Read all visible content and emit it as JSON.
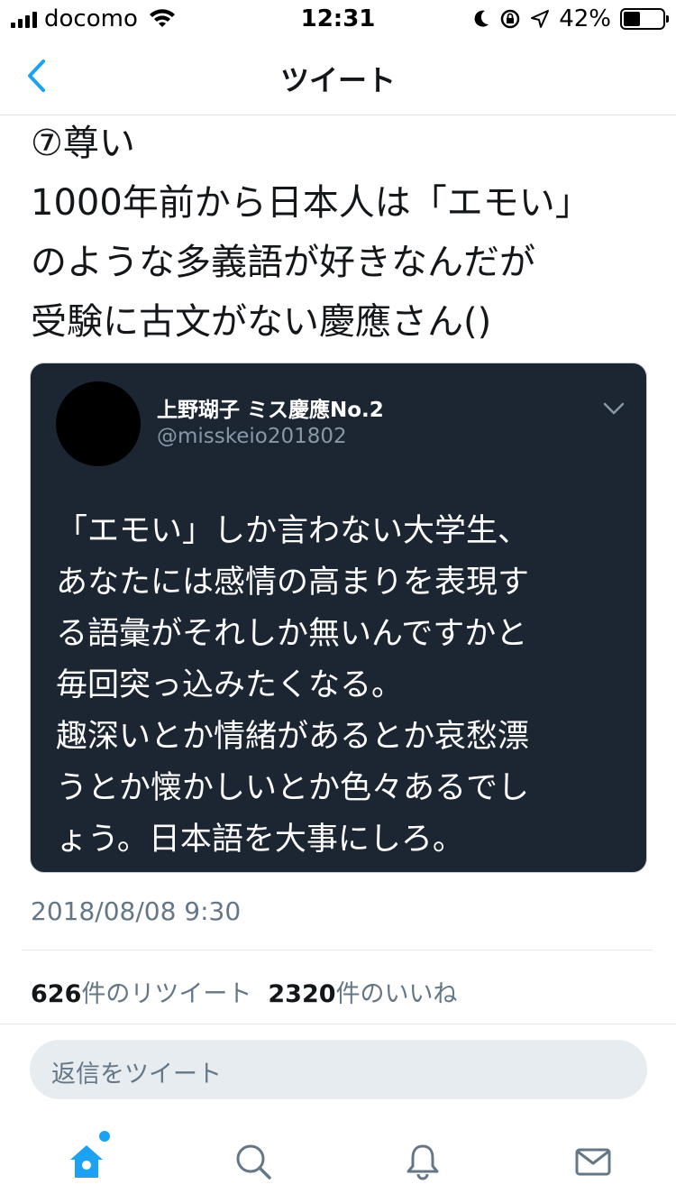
{
  "status_bar": {
    "carrier": "docomo",
    "time": "12:31",
    "battery_pct": "42%",
    "battery_level": 0.42
  },
  "nav": {
    "title": "ツイート",
    "back_icon": "chevron-left-icon"
  },
  "tweet": {
    "text": "⑦尊い\n1000年前から日本人は「エモい」\nのような多義語が好きなんだが\n受験に古文がない慶應さん()"
  },
  "embedded": {
    "name": "上野瑚子 ミス慶應No.2",
    "handle": "@misskeio201802",
    "body": "「エモい」しか言わない大学生、\nあなたには感情の高まりを表現す\nる語彙がそれしか無いんですかと\n毎回突っ込みたくなる。\n趣深いとか情緒があるとか哀愁漂\nうとか懐かしいとか色々あるでし\nょう。日本語を大事にしろ。"
  },
  "meta": {
    "timestamp": "2018/08/08 9:30",
    "retweet_count": "626",
    "retweet_label": "件のリツイート",
    "like_count": "2320",
    "like_label": "件のいいね"
  },
  "reply": {
    "placeholder": "返信をツイート"
  },
  "tabs": [
    {
      "icon": "home-icon"
    },
    {
      "icon": "search-icon"
    },
    {
      "icon": "bell-icon"
    },
    {
      "icon": "mail-icon"
    }
  ],
  "colors": {
    "accent": "#1da1f2",
    "embed_bg": "#1c2532"
  }
}
